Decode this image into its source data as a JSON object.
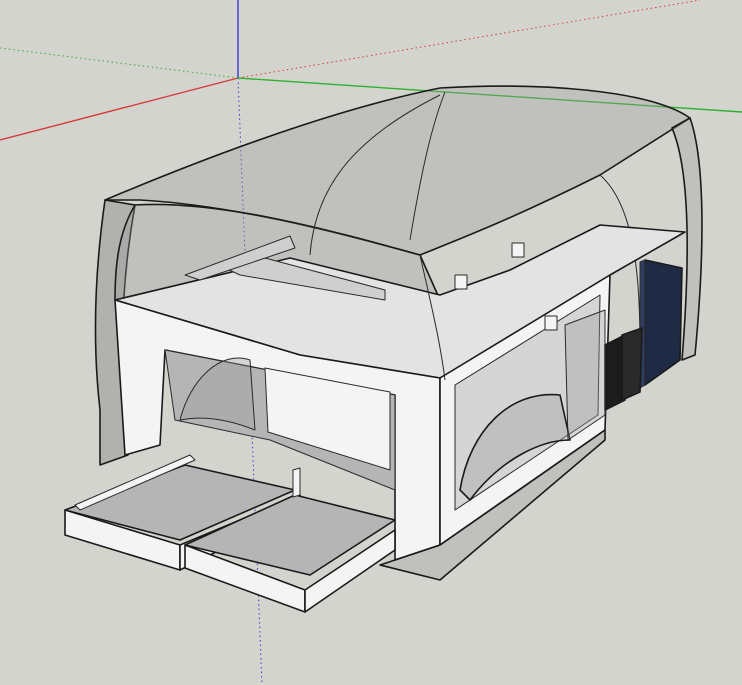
{
  "colors": {
    "background": "#d4d4cf",
    "axis_red": "#d43a3a",
    "axis_green": "#2fb02f",
    "axis_blue": "#3a3ad4",
    "cabinet_navy": "#1f2a44",
    "battery_black": "#1c1c1c"
  },
  "icons": [
    "model-axes",
    "camper-model"
  ]
}
